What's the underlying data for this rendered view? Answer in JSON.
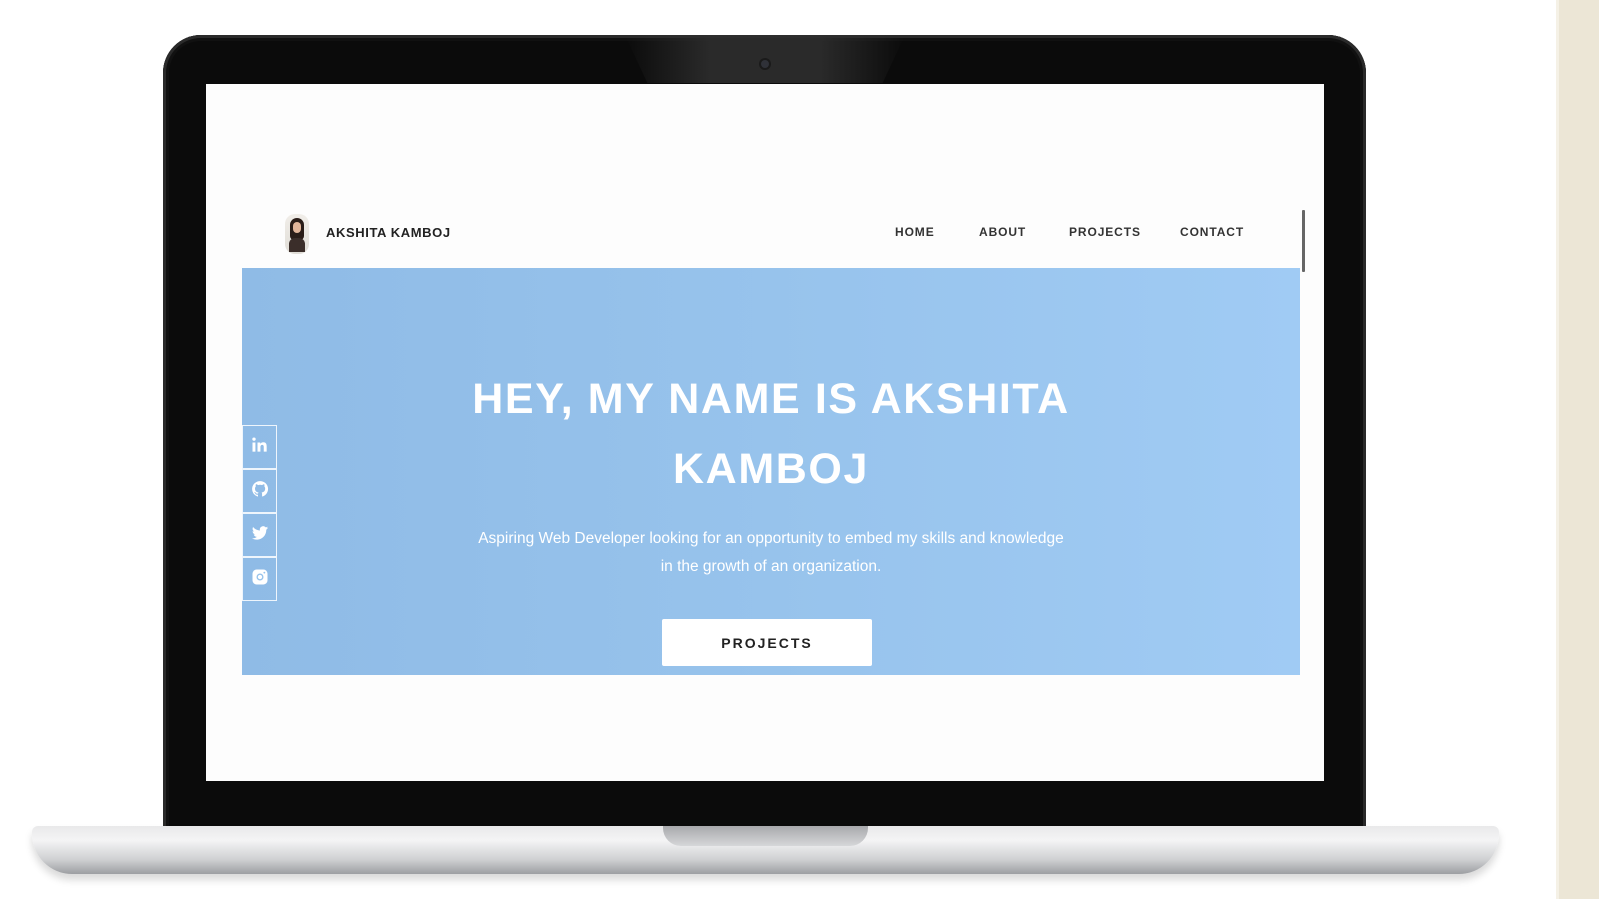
{
  "header": {
    "brand": "AKSHITA KAMBOJ",
    "nav": [
      {
        "label": "HOME"
      },
      {
        "label": "ABOUT"
      },
      {
        "label": "PROJECTS"
      },
      {
        "label": "CONTACT"
      }
    ]
  },
  "hero": {
    "title_line1": "HEY, MY NAME IS AKSHITA",
    "title_line2": "KAMBOJ",
    "subtitle_line1": "Aspiring Web Developer looking for an opportunity to embed my skills and knowledge",
    "subtitle_line2": "in the growth of an organization.",
    "button_label": "PROJECTS",
    "background_color": "#97c3ec"
  },
  "social_icons": [
    "linkedin-icon",
    "github-icon",
    "twitter-icon",
    "instagram-icon"
  ]
}
